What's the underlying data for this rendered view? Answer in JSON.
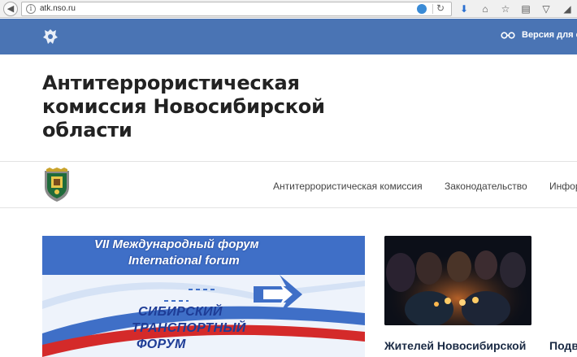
{
  "browser": {
    "url": "atk.nso.ru"
  },
  "header": {
    "accessibility_label": "Версия для сл"
  },
  "site": {
    "title_lines": [
      "Антитеррористическая",
      "комиссия Новосибирской",
      "области"
    ]
  },
  "nav": {
    "items": [
      {
        "label": "Антитеррористическая комиссия"
      },
      {
        "label": "Законодательство"
      },
      {
        "label": "Информ"
      }
    ]
  },
  "banner": {
    "line1": "VII Международный форум",
    "line2": "International forum",
    "big_lines": [
      "СИБИРСКИЙ",
      "ТРАНСПОРТНЫЙ",
      "ФОРУМ"
    ]
  },
  "news": {
    "title": "Жителей Новосибирской",
    "title2": "Подв"
  },
  "colors": {
    "topbar": "#4a74b4",
    "banner_blue": "#1e3c96",
    "banner_red": "#d42a2a"
  }
}
